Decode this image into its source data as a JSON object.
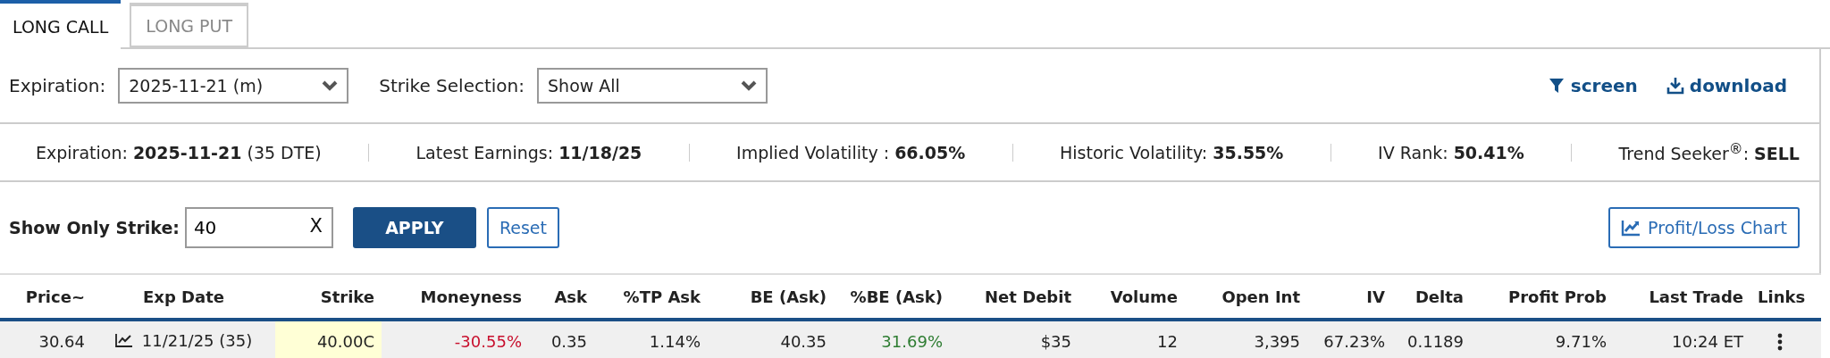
{
  "tabs": [
    {
      "label": "LONG CALL",
      "selected": true
    },
    {
      "label": "LONG PUT",
      "selected": false
    }
  ],
  "controls": {
    "expiration": {
      "label": "Expiration:",
      "value": "2025-11-21 (m)"
    },
    "strike_selection": {
      "label": "Strike Selection:",
      "value": "Show All"
    },
    "actions": [
      {
        "kind": "filter",
        "label": "screen"
      },
      {
        "kind": "download",
        "label": "download"
      }
    ]
  },
  "stats": [
    {
      "label": "Expiration:",
      "value": "2025-11-21",
      "suffix": "(35 DTE)"
    },
    {
      "label": "Latest Earnings:",
      "value": "11/18/25"
    },
    {
      "label": "Implied Volatility :",
      "value": "66.05%"
    },
    {
      "label": "Historic Volatility:",
      "value": "35.55%"
    },
    {
      "label": "IV Rank:",
      "value": "50.41%"
    },
    {
      "label": "Trend Seeker$^{®}$:",
      "value": "SELL"
    }
  ],
  "strike_filter": {
    "label": "Show Only Strike:",
    "value": "40",
    "clear": "X",
    "apply": "APPLY",
    "reset": "Reset"
  },
  "chart_button": "Profit/Loss Chart",
  "table": {
    "columns": [
      "Price~",
      "Exp Date",
      "Strike",
      "Moneyness",
      "Ask",
      "%TP Ask",
      "BE (Ask)",
      "%BE (Ask)",
      "Net Debit",
      "Volume",
      "Open Int",
      "IV",
      "Delta",
      "Profit Prob",
      "Last Trade",
      "Links"
    ],
    "rows": [
      {
        "cells": [
          {
            "text": "30.64"
          },
          {
            "text": "11/21/25 (35)",
            "chart_icon": true
          },
          {
            "text": "40.00C",
            "highlighted": true
          },
          {
            "text": "-30.55%",
            "color": "#c8102e"
          },
          {
            "text": "0.35"
          },
          {
            "text": "1.14%"
          },
          {
            "text": "40.35"
          },
          {
            "text": "31.69%",
            "color": "#2e7d32"
          },
          {
            "text": "$35"
          },
          {
            "text": "12"
          },
          {
            "text": "3,395"
          },
          {
            "text": "67.23%"
          },
          {
            "text": "0.1189"
          },
          {
            "text": "9.71%"
          },
          {
            "text": "10:24 ET"
          },
          {
            "kind": "menu"
          }
        ]
      }
    ]
  }
}
